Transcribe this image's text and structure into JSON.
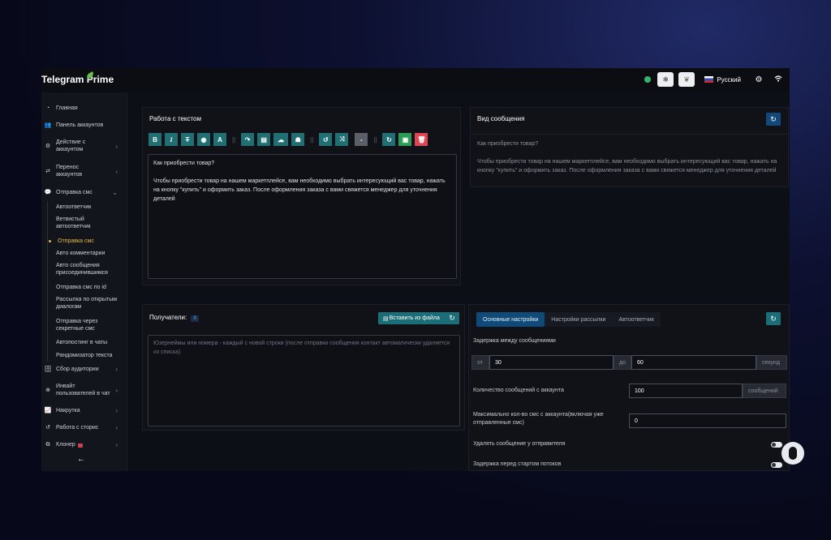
{
  "app": {
    "title": "Telegram Prime"
  },
  "topbar": {
    "language": "Русский"
  },
  "sidebar": {
    "items": [
      {
        "label": "Главная",
        "icon": "gauge-icon"
      },
      {
        "label": "Панель аккаунтов",
        "icon": "users-icon"
      },
      {
        "label": "Действие с аккаунтом",
        "icon": "sliders-icon"
      },
      {
        "label": "Перенос аккаунтов",
        "icon": "transfer-icon"
      },
      {
        "label": "Отправка смс",
        "icon": "chat-icon"
      }
    ],
    "sub_items": [
      "Автоответчик",
      "Ветвистый автоответчик",
      "Отправка смс",
      "Авто комментарии",
      "Авто сообщения присоединившимся",
      "Отправка смс по id",
      "Рассылка по открытым диалогам",
      "Отправка через секретные смс",
      "Автопостинг в чаты",
      "Рандомизатор текста"
    ],
    "bottom_items": [
      {
        "label": "Сбор аудитории",
        "icon": "database-icon"
      },
      {
        "label": "Инвайт пользователей в чат",
        "icon": "invite-icon"
      },
      {
        "label": "Накрутка",
        "icon": "chart-icon"
      },
      {
        "label": "Работа с сторис",
        "icon": "history-icon"
      },
      {
        "label": "Клонер",
        "icon": "clone-icon"
      }
    ]
  },
  "editor": {
    "title": "Работа с текстом",
    "content": "Как приобрести товар?\n\nЧтобы приобрести товар на нашем маркетплейсе, вам необходимо выбрать интересующий вас товар, нажать на кнопку \"купить\" и оформить заказ. После оформления заказа с вами свяжется менеджер для уточнения деталей"
  },
  "preview": {
    "title": "Вид сообщения",
    "line1": "Как приобрести товар?",
    "line2": "Чтобы приобрести товар на нашем маркетплейсе, вам необходимо выбрать интересующий вас товар, нажать на",
    "line3": "кнопку \"купить\" и оформить заказ. После оформления заказа с вами свяжется менеджер для уточнения деталей"
  },
  "recipients": {
    "title": "Получатели:",
    "count": "0",
    "paste_label": "Вставить из файла",
    "placeholder": "Юзернеймы или номера - каждый с новой строки (после отправки сообщения контакт автоматически удаляется из списка)"
  },
  "settings": {
    "tabs": [
      "Основные настройки",
      "Настройки рассылки",
      "Автоответчик"
    ],
    "delay_label": "Задержка между сообщениями",
    "from_label": "от",
    "from_value": "30",
    "to_label": "до",
    "to_value": "60",
    "unit_seconds": "секунд",
    "per_account_label": "Количество сообщений с аккаунта",
    "per_account_value": "100",
    "unit_messages": "сообщений",
    "max_label": "Максимально кол-во смс с аккаунта(включая уже отправленные смс)",
    "max_value": "0",
    "delete_label": "Удалять сообщение у отправителя",
    "start_delay_label": "Задержка перед стартом потоков"
  }
}
